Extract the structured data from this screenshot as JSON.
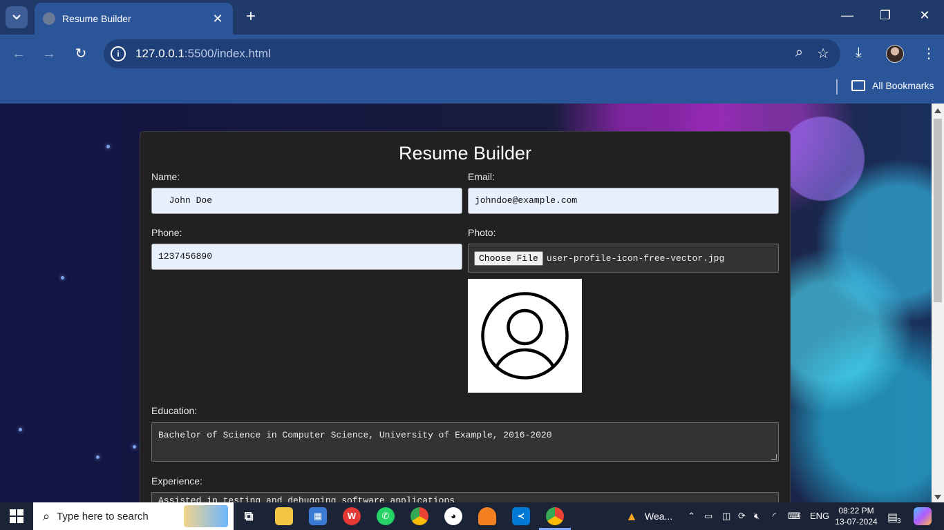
{
  "browser": {
    "tab_title": "Resume Builder",
    "url_host": "127.0.0.1",
    "url_path": ":5500/index.html",
    "bookmarks_label": "All Bookmarks"
  },
  "page": {
    "heading": "Resume Builder",
    "name_label": "Name:",
    "name_value": "  John Doe",
    "email_label": "Email:",
    "email_value": "johndoe@example.com",
    "phone_label": "Phone:",
    "phone_value": "1237456890",
    "photo_label": "Photo:",
    "choose_file_label": "Choose File",
    "file_name": "user-profile-icon-free-vector.jpg",
    "education_label": "Education:",
    "education_value": "Bachelor of Science in Computer Science, University of Example, 2016-2020",
    "experience_label": "Experience:",
    "experience_value": "Assisted in testing and debugging software applications"
  },
  "taskbar": {
    "search_placeholder": "Type here to search",
    "weather_label": "Wea...",
    "language": "ENG",
    "time": "08:22 PM",
    "date": "13-07-2024",
    "notification_count": "3"
  },
  "icons": [
    "tab-search-icon",
    "globe-icon",
    "close-icon",
    "new-tab-icon",
    "minimize-icon",
    "restore-icon",
    "back-icon",
    "forward-icon",
    "reload-icon",
    "info-icon",
    "zoom-icon",
    "star-icon",
    "download-icon",
    "menu-icon",
    "folder-icon",
    "user-profile-icon",
    "windows-icon",
    "search-icon"
  ]
}
